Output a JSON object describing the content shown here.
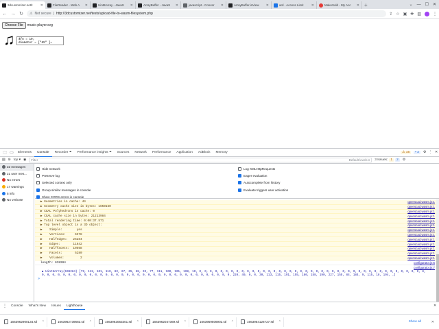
{
  "tabs": [
    {
      "title": "3dcustomizer.net/t",
      "fav": "black",
      "active": true
    },
    {
      "title": "FileReader - Web A",
      "fav": "black"
    },
    {
      "title": "Uint8Array - JavaS",
      "fav": "black"
    },
    {
      "title": "ArrayBuffer - JavaS",
      "fav": "black"
    },
    {
      "title": "javascript - Conver",
      "fav": "gray"
    },
    {
      "title": "ArrayBuffer.isView",
      "fav": "black"
    },
    {
      "title": "wsl - Access Limit",
      "fav": "blue"
    },
    {
      "title": "MakeSold - My Acc",
      "fav": "red"
    }
  ],
  "address": {
    "security": "Not secure",
    "url": "http://3dcustomizer.net/tests/upload-file-to-wasm-filesystem.php"
  },
  "page": {
    "choose_file": "Choose File",
    "file_name": "music-player.svg",
    "note_glyph": "♫",
    "code_line1": "$fn = 10;",
    "code_line2": "diameter = [\"65\" ]="
  },
  "devtools": {
    "tabs": [
      "Elements",
      "Console",
      "Recorder ⏶",
      "Performance insights ⏶",
      "Sources",
      "Network",
      "Performance",
      "Application",
      "AdBlock",
      "Memory"
    ],
    "active_tab": "Console",
    "warn_count": "16",
    "info_count": "2",
    "context": "top",
    "filter_placeholder": "Filter",
    "levels": "Default levels ▾",
    "issues": "3 Issues:",
    "issues_warn": "1",
    "issues_info": "2"
  },
  "sidebar": [
    {
      "label": "22 messages",
      "color": "#5f6368",
      "sel": true
    },
    {
      "label": "21 user mes...",
      "color": "#5f6368"
    },
    {
      "label": "No errors",
      "color": "#d93025"
    },
    {
      "label": "17 warnings",
      "color": "#f9ab00"
    },
    {
      "label": "5 info",
      "color": "#1a73e8"
    },
    {
      "label": "No verbose",
      "color": "#5f6368"
    }
  ],
  "settings_left": [
    {
      "label": "Hide network",
      "on": false
    },
    {
      "label": "Preserve log",
      "on": false
    },
    {
      "label": "Selected context only",
      "on": false
    },
    {
      "label": "Group similar messages in console",
      "on": true
    },
    {
      "label": "Show CORS errors in console",
      "on": true
    }
  ],
  "settings_right": [
    {
      "label": "Log XMLHttpRequests",
      "on": false
    },
    {
      "label": "Eager evaluation",
      "on": true
    },
    {
      "label": "Autocomplete from history",
      "on": true
    },
    {
      "label": "Evaluate triggers user activation",
      "on": true
    }
  ],
  "logs": [
    {
      "text": "▶ Geometries in cache: 44",
      "src": "openscad.wasm.js:1"
    },
    {
      "text": "▶ Geometry cache size in bytes: 1659160",
      "src": "openscad.wasm.js:1"
    },
    {
      "text": "▶ CGAL Polyhedrons in cache: 0",
      "src": "openscad.wasm.js:1"
    },
    {
      "text": "▶ CGAL cache size in bytes: 21213984",
      "src": "openscad.wasm.js:1"
    },
    {
      "text": "▶ Total rendering time: 0:00:37.571",
      "src": "openscad.wasm.js:1"
    },
    {
      "text": "▶ Top level object is a 3D object:",
      "src": "openscad.wasm.js:1"
    },
    {
      "text": "▶    Simple:        yes",
      "src": "openscad.wasm.js:1"
    },
    {
      "text": "▶    Vertices:     6378",
      "src": "openscad.wasm.js:1"
    },
    {
      "text": "▶    Halfedges:   25284",
      "src": "openscad.wasm.js:1"
    },
    {
      "text": "▶    Edges:       11642",
      "src": "openscad.wasm.js:1"
    },
    {
      "text": "▶    Halffacets:  10568",
      "src": "openscad.wasm.js:1"
    },
    {
      "text": "▶    Facets:       5280",
      "src": "openscad.wasm.js:1"
    },
    {
      "text": "▶    Volumes:         2",
      "src": "openscad.wasm.js:1"
    }
  ],
  "length_line": {
    "text": "length: 638284",
    "src": "configurator.js:6"
  },
  "array_line": {
    "src": "configurator.js:7",
    "text": "▶ Uint8Array(638284) [79, 112, 101, 110, 83, 67, 65, 68, 32, 77, 111, 100, 101, 108, 10, 0, 0, 0, 0, 0, 0, 0, 0, 0, 0, 0, 0, 0, 0, 0, 0, 0, 0, 0, 0, 0, 0, 0, 0, 0, 0, 0, 0, 0, 0, 0, 0, 0, 0, 0, 0, 0, 0, 0, 0, 0, 0, 0, 0, 0, 0, 0, 0, 0, 0, 0, 0, 0, 0, 0, 0, 0, 0, 0, 0, 0, 0, 0, 0, 0, 0, 0, 0, 0, 0, 0, 0, 0, 0, 0, 0, 0, 0, 0, 220, 49, 0, 0, 30, 113, 115, 191, 155, 180, 158, 190, 227, 155, 84, 184, 9, 115, 18, 194, …]"
  },
  "prompt": ">",
  "drawer_tabs": [
    "Console",
    "What's New",
    "Issues",
    "Lighthouse"
  ],
  "downloads": [
    "1663962900134.stl",
    "1663962739683.stl",
    "1663962053301.stl",
    "1663962047369.stl",
    "1663959506902.stl",
    "1663954126727.stl"
  ],
  "show_all": "Show all"
}
